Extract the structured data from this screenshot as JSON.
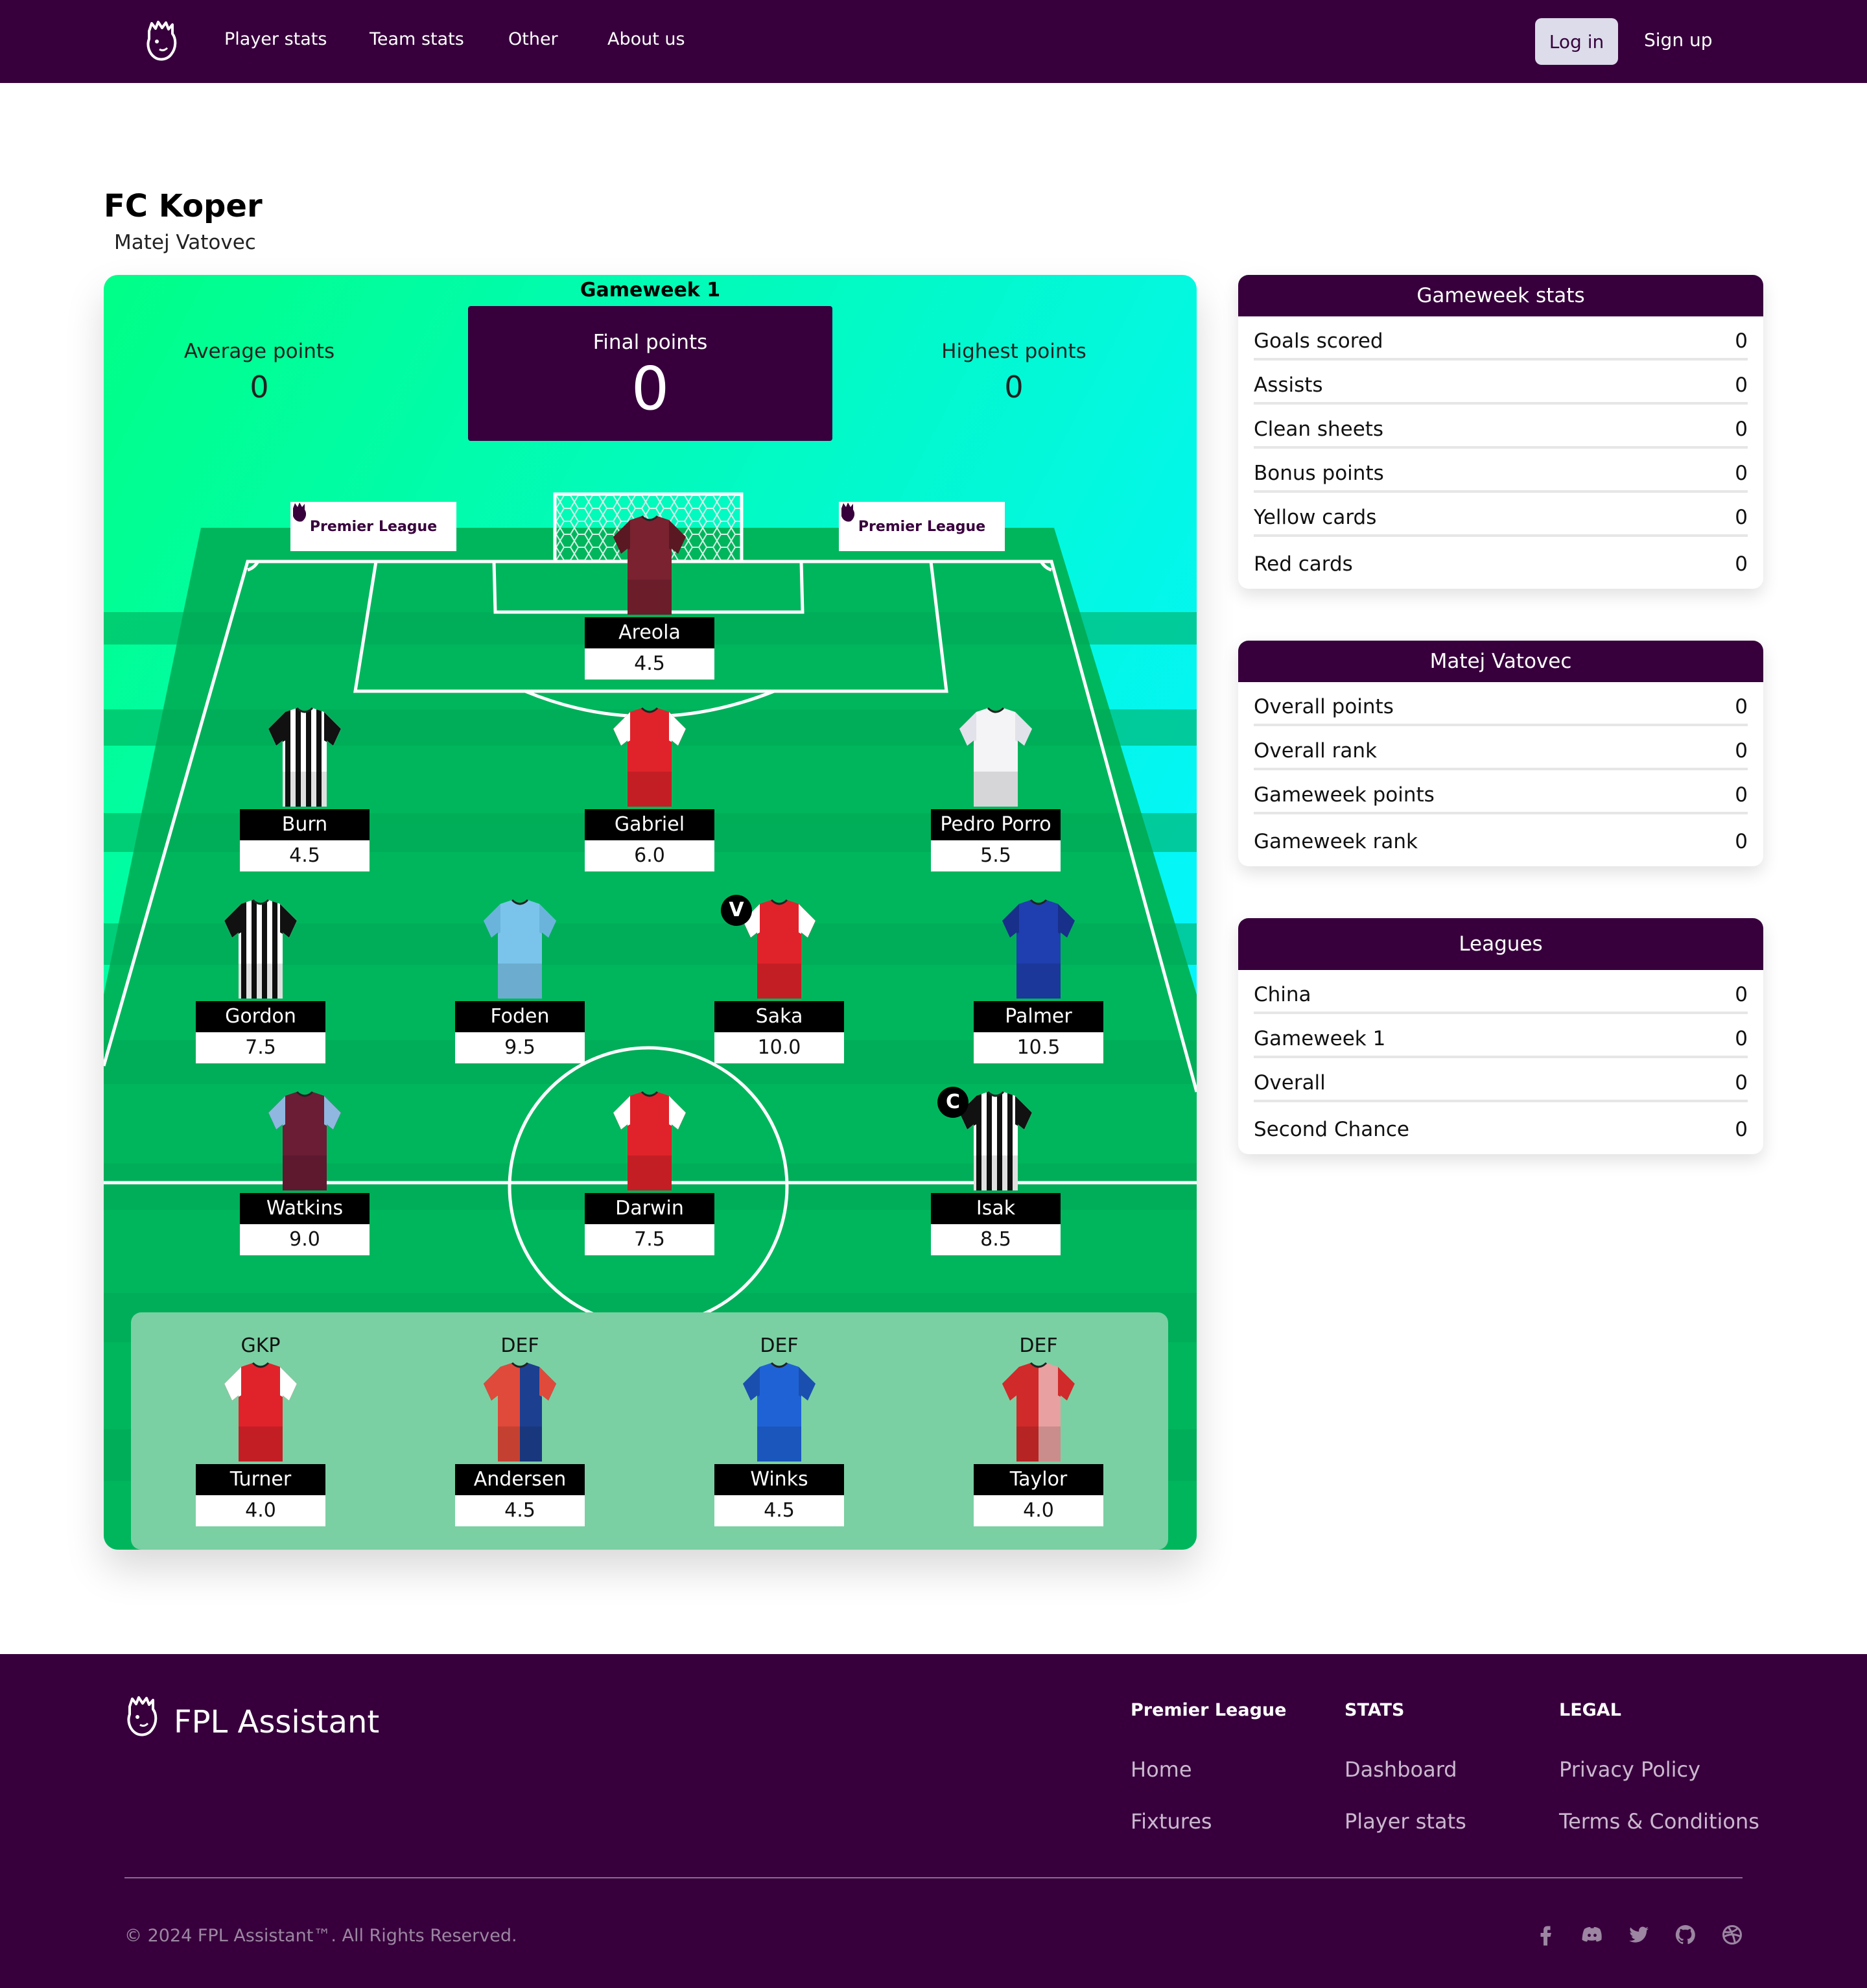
{
  "nav": {
    "links": [
      "Player stats",
      "Team stats",
      "Other",
      "About us"
    ],
    "login": "Log in",
    "signup": "Sign up"
  },
  "team": {
    "name": "FC Koper",
    "manager": "Matej Vatovec"
  },
  "gameweek": {
    "title": "Gameweek 1",
    "average_label": "Average points",
    "average_value": "0",
    "final_label": "Final points",
    "final_value": "0",
    "highest_label": "Highest points",
    "highest_value": "0",
    "board_text_left": "Premier",
    "board_text_right": "League"
  },
  "squad": {
    "gk": [
      {
        "name": "Areola",
        "price": "4.5",
        "shirt": "maroon"
      }
    ],
    "def": [
      {
        "name": "Burn",
        "price": "4.5",
        "shirt": "stripes"
      },
      {
        "name": "Gabriel",
        "price": "6.0",
        "shirt": "red"
      },
      {
        "name": "Pedro Porro",
        "price": "5.5",
        "shirt": "white"
      }
    ],
    "mid": [
      {
        "name": "Gordon",
        "price": "7.5",
        "shirt": "stripes"
      },
      {
        "name": "Foden",
        "price": "9.5",
        "shirt": "skyblue"
      },
      {
        "name": "Saka",
        "price": "10.0",
        "shirt": "red",
        "badge": "V"
      },
      {
        "name": "Palmer",
        "price": "10.5",
        "shirt": "blue"
      }
    ],
    "fwd": [
      {
        "name": "Watkins",
        "price": "9.0",
        "shirt": "claret"
      },
      {
        "name": "Darwin",
        "price": "7.5",
        "shirt": "red"
      },
      {
        "name": "Isak",
        "price": "8.5",
        "shirt": "stripes",
        "badge": "C"
      }
    ],
    "bench": [
      {
        "pos": "GKP",
        "name": "Turner",
        "price": "4.0",
        "shirt": "red"
      },
      {
        "pos": "DEF",
        "name": "Andersen",
        "price": "4.5",
        "shirt": "redblue"
      },
      {
        "pos": "DEF",
        "name": "Winks",
        "price": "4.5",
        "shirt": "royal"
      },
      {
        "pos": "DEF",
        "name": "Taylor",
        "price": "4.0",
        "shirt": "saints"
      }
    ]
  },
  "gameweek_stats": {
    "title": "Gameweek stats",
    "rows": [
      {
        "label": "Goals scored",
        "value": "0"
      },
      {
        "label": "Assists",
        "value": "0"
      },
      {
        "label": "Clean sheets",
        "value": "0"
      },
      {
        "label": "Bonus points",
        "value": "0"
      },
      {
        "label": "Yellow cards",
        "value": "0"
      },
      {
        "label": "Red cards",
        "value": "0"
      }
    ]
  },
  "manager_stats": {
    "title": "Matej Vatovec",
    "rows": [
      {
        "label": "Overall points",
        "value": "0"
      },
      {
        "label": "Overall rank",
        "value": "0"
      },
      {
        "label": "Gameweek points",
        "value": "0"
      },
      {
        "label": "Gameweek rank",
        "value": "0"
      }
    ]
  },
  "leagues": {
    "title": "Leagues",
    "rows": [
      {
        "label": "China",
        "value": "0"
      },
      {
        "label": "Gameweek 1",
        "value": "0"
      },
      {
        "label": "Overall",
        "value": "0"
      },
      {
        "label": "Second Chance",
        "value": "0"
      }
    ]
  },
  "footer": {
    "brand": "FPL Assistant",
    "col1_title": "Premier League",
    "col1_links": [
      "Home",
      "Fixtures"
    ],
    "col2_title": "STATS",
    "col2_links": [
      "Dashboard",
      "Player stats"
    ],
    "col3_title": "LEGAL",
    "col3_links": [
      "Privacy Policy",
      "Terms & Conditions"
    ],
    "copyright": "© 2024 FPL Assistant™. All Rights Reserved.",
    "social_icons": [
      "facebook-icon",
      "discord-icon",
      "twitter-icon",
      "github-icon",
      "dribbble-icon"
    ]
  },
  "colors": {
    "brand_purple": "#37003c",
    "pitch_green": "#00b35a",
    "sky_gradient_start": "#00ff87",
    "sky_gradient_end": "#04f5ff"
  }
}
